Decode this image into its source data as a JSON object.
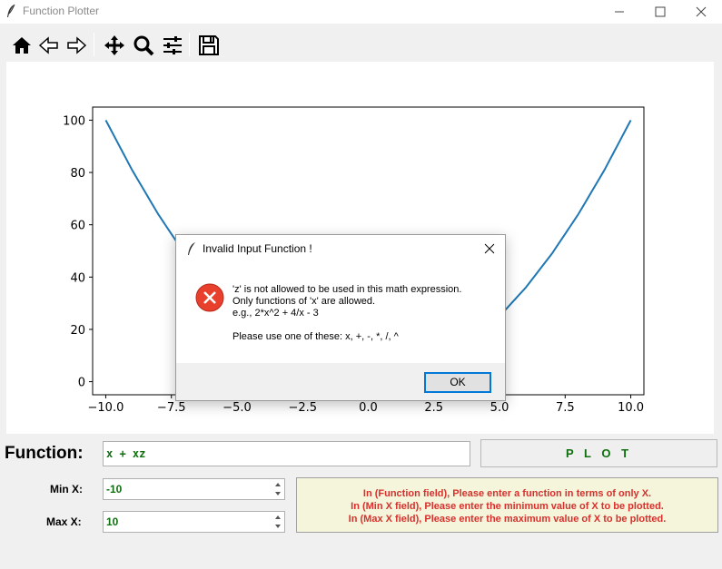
{
  "window": {
    "title": "Function Plotter",
    "icon": "feather-icon"
  },
  "toolbar": {
    "buttons": [
      {
        "name": "home",
        "icon": "home-icon"
      },
      {
        "name": "back",
        "icon": "back-arrow-icon"
      },
      {
        "name": "forward",
        "icon": "forward-arrow-icon"
      },
      {
        "name": "pan",
        "icon": "pan-move-icon"
      },
      {
        "name": "zoom",
        "icon": "zoom-icon"
      },
      {
        "name": "configure",
        "icon": "sliders-icon"
      },
      {
        "name": "save",
        "icon": "save-icon"
      }
    ]
  },
  "chart_data": {
    "type": "line",
    "title": "",
    "xlabel": "",
    "ylabel": "",
    "x": [
      -10,
      -9,
      -8,
      -7,
      -6,
      -5,
      -4,
      -3,
      -2,
      -1,
      0,
      1,
      2,
      3,
      4,
      5,
      6,
      7,
      8,
      9,
      10
    ],
    "series": [
      {
        "values": [
          100,
          81,
          64,
          49,
          36,
          25,
          16,
          9,
          4,
          1,
          0,
          1,
          4,
          9,
          16,
          25,
          36,
          49,
          64,
          81,
          100
        ],
        "color": "#1f77b4"
      }
    ],
    "xlim": [
      -10.5,
      10.5
    ],
    "ylim": [
      -5,
      105
    ],
    "xticks": [
      "−10.0",
      "−7.5",
      "−5.0",
      "−2.5",
      "0.0",
      "2.5",
      "5.0",
      "7.5",
      "10.0"
    ],
    "xtick_values": [
      -10,
      -7.5,
      -5,
      -2.5,
      0,
      2.5,
      5,
      7.5,
      10
    ],
    "yticks": [
      "0",
      "20",
      "40",
      "60",
      "80",
      "100"
    ],
    "ytick_values": [
      0,
      20,
      40,
      60,
      80,
      100
    ],
    "grid": false
  },
  "dialog": {
    "title": "Invalid Input Function !",
    "icon": "error-icon",
    "line1": "'z' is not allowed to be used in this math expression.",
    "line2": "Only functions of 'x' are allowed.",
    "line3": "e.g., 2*x^2 + 4/x - 3",
    "line4": "Please use one of these: x, +, -, *, /, ^",
    "ok_label": "OK"
  },
  "form": {
    "function_label": "Function:",
    "function_value": "x + xz",
    "plot_label": "P L O T",
    "min_label": "Min X:",
    "min_value": "-10",
    "max_label": "Max X:",
    "max_value": "10"
  },
  "help": {
    "line1": "In (Function field), Please enter a function in terms of only X.",
    "line2": "In (Min X field), Please enter the minimum value of X to be plotted.",
    "line3": "In (Max X field), Please enter the maximum value of X to be plotted."
  },
  "colors": {
    "accent": "#0078d7",
    "help_text": "#d8302c",
    "input_text": "#0f6e0f",
    "help_bg": "#f5f5dc",
    "line": "#1f77b4"
  }
}
